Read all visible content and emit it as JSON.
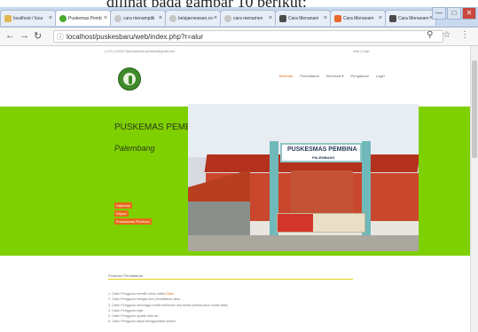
{
  "caption": "dilihat pada gambar 10 berikut:",
  "tabs": [
    {
      "label": "localhost / loca",
      "color": "#e2b64f",
      "active": false
    },
    {
      "label": "Puskemas Pemb",
      "color": "#4bab2c",
      "active": true
    },
    {
      "label": "cara menampilk",
      "color": "#c6c6c6",
      "active": false
    },
    {
      "label": "belajarnewsan.co",
      "color": "#c6c6c6",
      "active": false
    },
    {
      "label": "cara menamen",
      "color": "#c6c6c6",
      "active": false
    },
    {
      "label": "Cara Menanam",
      "color": "#4b4b4b",
      "active": false
    },
    {
      "label": "Cara Menanam",
      "color": "#e7682a",
      "active": false
    },
    {
      "label": "Cara Menanam",
      "color": "#4b4b4b",
      "active": false
    }
  ],
  "window_controls": [
    "—",
    "□",
    "✕"
  ],
  "url": "localhost/puskesbaru/web/index.php?r=alur",
  "toolbar_icons": "⚲ ☆ ⋮",
  "page": {
    "topinfo_left": "(+)711-412022   @puskesmas.pembina@gmail.com",
    "topinfo_right": "Help   |   Login",
    "menu": [
      {
        "label": "Beranda",
        "active": true
      },
      {
        "label": "Pendaftaran",
        "active": false
      },
      {
        "label": "Informasi ▾",
        "active": false
      },
      {
        "label": "Pengaduan",
        "active": false
      },
      {
        "label": "Login",
        "active": false
      }
    ],
    "hero": {
      "title": "PUSKEMAS PEMBINA",
      "subtitle": "Palembang",
      "badges": [
        "Halaman",
        "Depan",
        "Puskesmas Pembina"
      ]
    },
    "photo_sign": {
      "main": "PUSKESMAS PEMBINA",
      "sub": "PALEMBANG"
    },
    "section": {
      "title": "Prosedur Pendaftaran",
      "steps": [
        {
          "text": "1. Calon Pengguna memilih menu daftar ",
          "link": "Disini",
          "after": ""
        },
        {
          "text": "2. Calon Pengguna mengisi form pendaftaran akun",
          "link": "",
          "after": ""
        },
        {
          "text": "3. Calon Pengguna menunggu email konfirmasi dari admin (bahwa akun sudah aktif)",
          "link": "",
          "after": ""
        },
        {
          "text": "4. Calon Pengguna login",
          "link": "",
          "after": ""
        },
        {
          "text": "5. Calon Pengguna update data diri",
          "link": "",
          "after": ""
        },
        {
          "text": "6. Calon Pengguna dapat menggunakan sistem.",
          "link": "",
          "after": ""
        }
      ]
    }
  }
}
